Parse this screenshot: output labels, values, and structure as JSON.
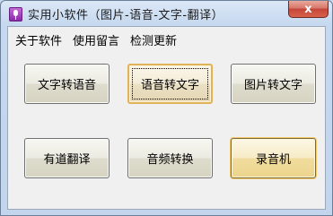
{
  "window": {
    "title": "实用小软件（图片-语音-文字-翻译）",
    "close_glyph": "x"
  },
  "menu": {
    "items": [
      "关于软件",
      "使用留言",
      "检测更新"
    ]
  },
  "buttons": {
    "text_to_speech": "文字转语音",
    "speech_to_text": "语音转文字",
    "image_to_text": "图片转文字",
    "youdao_translate": "有道翻译",
    "audio_convert": "音频转换",
    "recorder": "录音机"
  }
}
